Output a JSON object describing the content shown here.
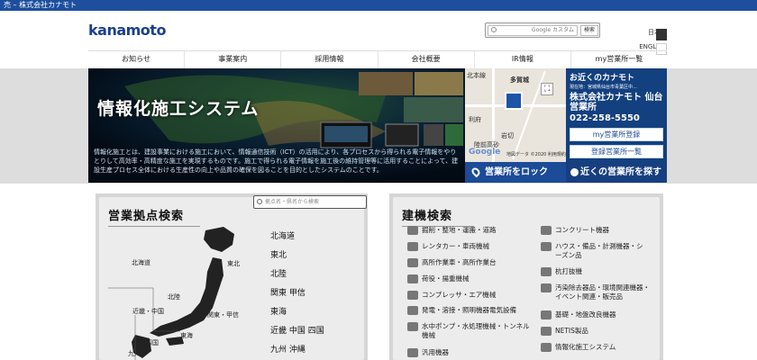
{
  "topbar": {
    "text": "売 – 株式会社カナモト"
  },
  "header": {
    "logo": "kanamoto",
    "search_placeholder": "Google カスタム",
    "search_button": "検索",
    "lang_ja": "日本語",
    "lang_en": "ENGLISH"
  },
  "nav": {
    "items": [
      {
        "label": "お知らせ"
      },
      {
        "label": "事業案内"
      },
      {
        "label": "採用情報"
      },
      {
        "label": "会社概要"
      },
      {
        "label": "IR情報"
      },
      {
        "label": "my営業所一覧"
      }
    ]
  },
  "banner": {
    "title": "情報化施工システム",
    "text": "情報化施工とは、建設事業における施工において、情報通信技術（ICT）の活用により、各プロセスから得られる電子情報をやりとりして高効率・高精度な施工を実現するものです。施工で得られる電子情報を施工後の維持管理等に活用することによって、建設生産プロセス全体における生産性の向上や品質の確保を図ることを目的としたシステムのことです。"
  },
  "map": {
    "labels": [
      "北本線",
      "多賀城",
      "利府",
      "岩切",
      "陸前高砂"
    ],
    "google": "Google",
    "credit": "地図データ ©2020  利用規約",
    "lock_label": "営業所をロック"
  },
  "near": {
    "title": "お近くのカナモト",
    "address": "現在地：宮城県仙台市青葉区中…",
    "office_name": "株式会社カナモト 仙台営業所",
    "tel": "022-258-5550",
    "register_button": "my営業所登録",
    "list_button": "登録営業所一覧",
    "search_label": "近くの営業所を探す"
  },
  "office_search": {
    "title": "営業拠点検索",
    "placeholder": "拠点名・県名から検索",
    "map_labels": [
      "北海道",
      "東北",
      "北陸",
      "近畿・中国",
      "関東・甲信",
      "東海",
      "四国",
      "九州"
    ],
    "regions": [
      "北海道",
      "東北",
      "北陸",
      "関東 甲信",
      "東海",
      "近畿 中国 四国",
      "九州 沖縄"
    ]
  },
  "machine_search": {
    "title": "建機検索",
    "left": [
      "掘削・整地・運搬・道路",
      "レンタカー・車両機械",
      "高所作業車・高所作業台",
      "荷役・揚重機械",
      "コンプレッサ・エア機械",
      "発電・溶接・照明機器電気設備",
      "水中ポンプ・水処理機械・トンネル機械",
      "汎用機器"
    ],
    "right": [
      "コンクリート機器",
      "ハウス・備品・計測機器・シーズン品",
      "杭打抜機",
      "汚染除去器品・環境関連機器・イベント関連・販売品",
      "基礎・地盤改良機器",
      "NETIS製品",
      "情報化施工システム"
    ]
  }
}
